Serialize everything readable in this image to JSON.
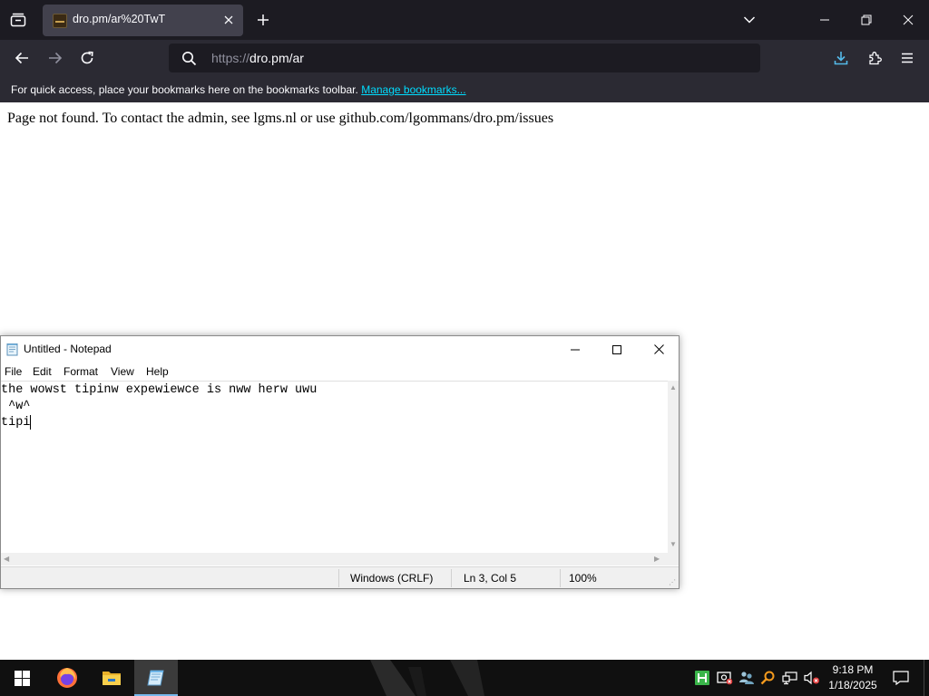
{
  "browser": {
    "tab": {
      "title": "dro.pm/ar%20TwT"
    },
    "url": {
      "scheme": "https://",
      "host_path": "dro.pm/ar"
    },
    "bookmarks_bar": {
      "message": "For quick access, place your bookmarks here on the bookmarks toolbar.",
      "link": "Manage bookmarks..."
    },
    "icons": [
      "tab-list-icon",
      "close-icon",
      "plus-icon",
      "chevron-down-icon",
      "minimize-icon",
      "restore-icon",
      "close-icon",
      "back-arrow-icon",
      "forward-arrow-icon",
      "reload-icon",
      "search-icon",
      "download-icon",
      "puzzle-icon",
      "hamburger-menu-icon"
    ],
    "colors": {
      "tabbar_bg": "#1c1b22",
      "toolbar_bg": "#2b2a33",
      "active_tab_bg": "#42414d",
      "link": "#00ddff",
      "download_accent": "#54b9e8"
    }
  },
  "page": {
    "message": "Page not found. To contact the admin, see lgms.nl or use github.com/lgommans/dro.pm/issues"
  },
  "notepad": {
    "title": "Untitled - Notepad",
    "menu": [
      "File",
      "Edit",
      "Format",
      "View",
      "Help"
    ],
    "lines": [
      "the wowst tipinw expewiewce is nww herw uwu",
      " ^w^",
      "tipi"
    ],
    "status": {
      "line_ending": "Windows (CRLF)",
      "position": "Ln 3, Col 5",
      "zoom": "100%"
    }
  },
  "taskbar": {
    "apps": [
      "windows-start-icon",
      "firefox-icon",
      "file-explorer-icon",
      "notepad-icon"
    ],
    "active_app": "notepad",
    "tray_icons": [
      "hx-icon",
      "security-icon",
      "people-icon",
      "search-icon",
      "network-icon",
      "volume-muted-icon"
    ],
    "clock": {
      "time": "9:18 PM",
      "date": "1/18/2025"
    },
    "colors": {
      "taskbar_bg": "#101010",
      "active_indicator": "#76b9ed"
    }
  }
}
